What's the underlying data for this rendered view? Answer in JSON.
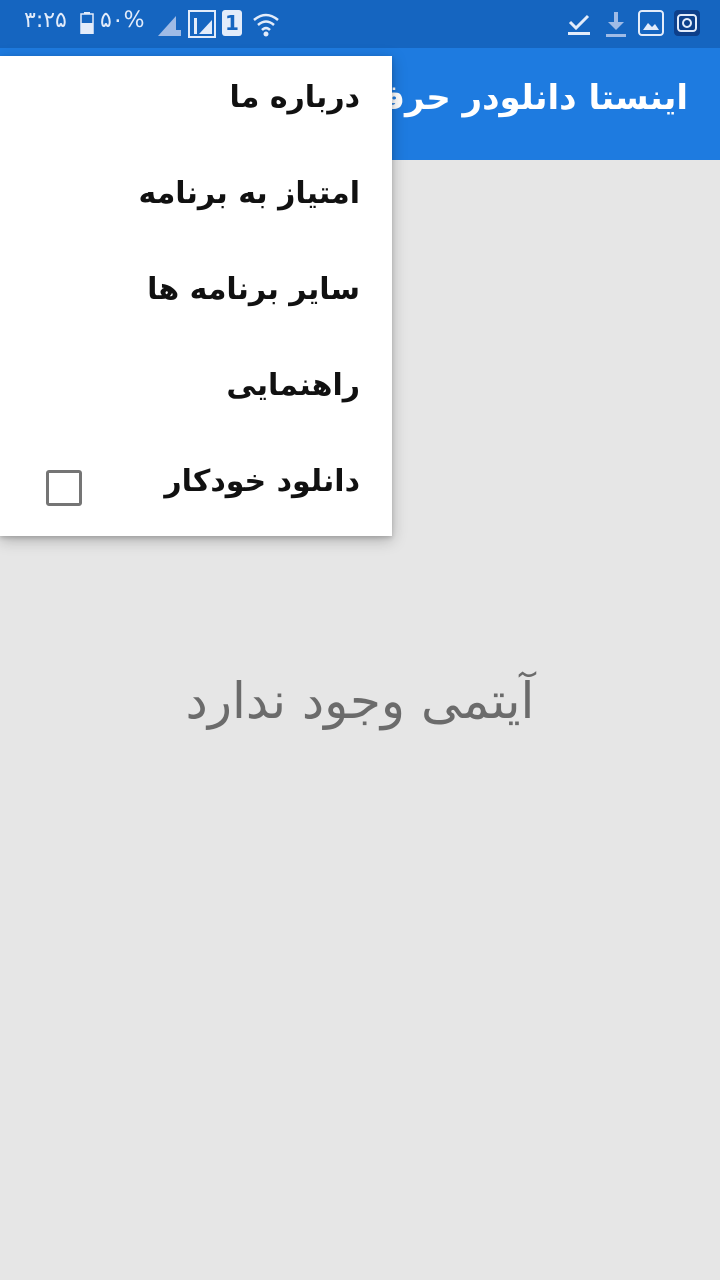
{
  "status_bar": {
    "time": "۳:۲۵",
    "battery": "۵۰%",
    "sim_slot": "1",
    "icons": [
      "battery-icon",
      "signal-icon",
      "signal-data-icon",
      "sim-icon",
      "wifi-icon",
      "check-icon",
      "download-icon",
      "image-icon",
      "instagram-icon"
    ]
  },
  "app_bar": {
    "title": "اینستا دانلودر حرفه"
  },
  "menu": {
    "items": [
      {
        "label": "درباره ما"
      },
      {
        "label": "امتیاز به برنامه"
      },
      {
        "label": "سایر برنامه ها"
      },
      {
        "label": "راهنمایی"
      },
      {
        "label": "دانلود خودکار",
        "checked": false
      }
    ]
  },
  "empty_state": {
    "text": "آیتمی وجود ندارد"
  },
  "colors": {
    "status_bar": "#1565c0",
    "app_bar": "#1e7be0",
    "background": "#e6e6e6",
    "menu": "#ffffff"
  }
}
